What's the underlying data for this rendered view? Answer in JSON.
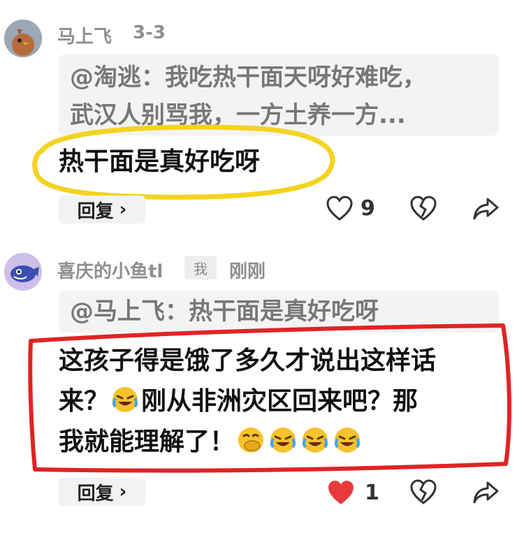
{
  "comment1": {
    "username": "马上飞",
    "time": "3-3",
    "quote": "@淘逃：我吃热干面天呀好难吃，\n武汉人别骂我，一方土养一方...",
    "text": "热干面是真好吃呀",
    "reply_label": "回复",
    "like_count": "9"
  },
  "comment2": {
    "username": "喜庆的小鱼tl",
    "badge": "我",
    "time": "刚刚",
    "quote": "@马上飞：热干面是真好吃呀",
    "line1": "这孩子得是饿了多久才说出这样话",
    "line2a": "来？",
    "line2b": "刚从非洲灾区回来吧？那",
    "line3": "我就能理解了！",
    "reply_label": "回复",
    "like_count": "1"
  },
  "icons": {
    "chevron": "›",
    "heart": "heart-icon",
    "dislike": "broken-heart-icon",
    "share": "share-icon"
  },
  "colors": {
    "highlight_yellow": "#f4d21f",
    "highlight_red": "#e02424",
    "liked_red": "#e83a3a"
  }
}
